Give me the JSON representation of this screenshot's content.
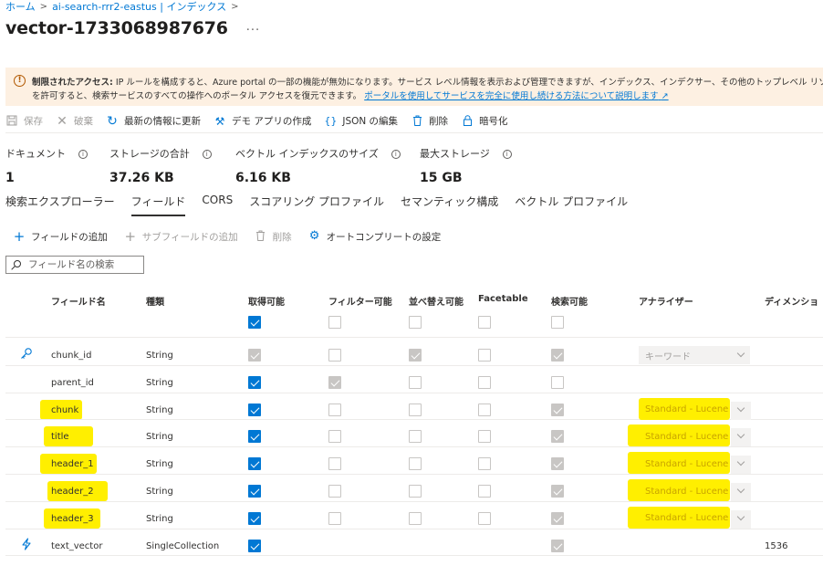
{
  "breadcrumb": {
    "home": "ホーム",
    "service": "ai-search-rrr2-eastus | インデックス"
  },
  "page_title": "vector-1733068987676",
  "more_label": "···",
  "banner": {
    "bold": "制限されたアクセス:",
    "line1": "IP ルールを構成すると、Azure portal の一部の機能が無効になります。サービス レベル情報を表示および管理できますが、インデックス、インデクサー、その他のトップレベル リソ",
    "line2": "を許可すると、検索サービスのすべての操作へのポータル アクセスを復元できます。",
    "link": "ポータルを使用してサービスを完全に使用し続ける方法について説明します"
  },
  "toolbar": {
    "save": "保存",
    "discard": "破棄",
    "refresh": "最新の情報に更新",
    "demo_app": "デモ アプリの作成",
    "edit_json": "JSON の編集",
    "delete": "削除",
    "encrypt": "暗号化"
  },
  "stats": {
    "documents_label": "ドキュメント",
    "documents_value": "1",
    "storage_label": "ストレージの合計",
    "storage_value": "37.26 KB",
    "vector_label": "ベクトル インデックスのサイズ",
    "vector_value": "6.16 KB",
    "max_storage_label": "最大ストレージ",
    "max_storage_value": "15 GB"
  },
  "tabs": [
    "検索エクスプローラー",
    "フィールド",
    "CORS",
    "スコアリング プロファイル",
    "セマンティック構成",
    "ベクトル プロファイル"
  ],
  "field_toolbar": {
    "add_field": "フィールドの追加",
    "add_subfield": "サブフィールドの追加",
    "delete": "削除",
    "autocomplete": "オートコンプリートの設定"
  },
  "search": {
    "placeholder": "フィールド名の検索"
  },
  "columns": {
    "field_name": "フィールド名",
    "type": "種類",
    "retrievable": "取得可能",
    "filterable": "フィルター可能",
    "sortable": "並べ替え可能",
    "facetable": "Facetable",
    "searchable": "検索可能",
    "analyzer": "アナライザー",
    "dimensions": "ディメンショ"
  },
  "header_checks": {
    "retrievable": "checked",
    "filterable": "disabled",
    "sortable": "disabled",
    "facetable": "disabled",
    "searchable": "disabled"
  },
  "rows": [
    {
      "icon": "key-icon",
      "name": "chunk_id",
      "type": "String",
      "retrievable": "checked-disabled",
      "filterable": "disabled",
      "sortable": "checked-disabled",
      "facetable": "disabled",
      "searchable": "checked-disabled",
      "analyzer": "キーワード",
      "dimensions": ""
    },
    {
      "icon": "",
      "name": "parent_id",
      "type": "String",
      "retrievable": "checked",
      "filterable": "checked-disabled",
      "sortable": "disabled",
      "facetable": "disabled",
      "searchable": "disabled",
      "analyzer": "",
      "dimensions": ""
    },
    {
      "icon": "",
      "name": "chunk",
      "type": "String",
      "retrievable": "checked",
      "filterable": "disabled",
      "sortable": "disabled",
      "facetable": "disabled",
      "searchable": "checked-disabled",
      "analyzer": "Standard - Lucene",
      "dimensions": ""
    },
    {
      "icon": "",
      "name": "title",
      "type": "String",
      "retrievable": "checked",
      "filterable": "disabled",
      "sortable": "disabled",
      "facetable": "disabled",
      "searchable": "checked-disabled",
      "analyzer": "Standard - Lucene",
      "dimensions": ""
    },
    {
      "icon": "",
      "name": "header_1",
      "type": "String",
      "retrievable": "checked",
      "filterable": "disabled",
      "sortable": "disabled",
      "facetable": "disabled",
      "searchable": "checked-disabled",
      "analyzer": "Standard - Lucene",
      "dimensions": ""
    },
    {
      "icon": "",
      "name": "header_2",
      "type": "String",
      "retrievable": "checked",
      "filterable": "disabled",
      "sortable": "disabled",
      "facetable": "disabled",
      "searchable": "checked-disabled",
      "analyzer": "Standard - Lucene",
      "dimensions": ""
    },
    {
      "icon": "",
      "name": "header_3",
      "type": "String",
      "retrievable": "checked",
      "filterable": "disabled",
      "sortable": "disabled",
      "facetable": "disabled",
      "searchable": "checked-disabled",
      "analyzer": "Standard - Lucene",
      "dimensions": ""
    },
    {
      "icon": "vector-bolt-icon",
      "name": "text_vector",
      "type": "SingleCollection",
      "retrievable": "checked",
      "filterable": "",
      "sortable": "",
      "facetable": "",
      "searchable": "checked-disabled",
      "analyzer": "",
      "dimensions": "1536"
    }
  ],
  "highlight_color": "#ffef00",
  "accent_color": "#0078d4"
}
